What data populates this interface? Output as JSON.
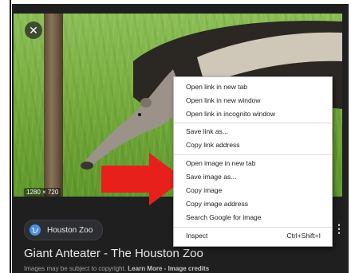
{
  "image_viewer": {
    "dimensions_label": "1280 × 720",
    "close_icon": "close-icon"
  },
  "source": {
    "name": "Houston Zoo",
    "icon": "globe-icon"
  },
  "result": {
    "title": "Giant Anteater - The Houston Zoo",
    "copyright_prefix": "Images may be subject to copyright.",
    "learn_more": "Learn More",
    "separator": "-",
    "image_credits": "Image credits"
  },
  "context_menu": {
    "group1": [
      "Open link in new tab",
      "Open link in new window",
      "Open link in incognito window"
    ],
    "group2": [
      "Save link as...",
      "Copy link address"
    ],
    "group3": [
      "Open image in new tab",
      "Save image as...",
      "Copy image",
      "Copy image address",
      "Search Google for image"
    ],
    "inspect": {
      "label": "Inspect",
      "shortcut": "Ctrl+Shift+I"
    }
  },
  "colors": {
    "panel_bg": "#1f1f1f",
    "arrow": "#e8201c",
    "grass": "#77ad3d"
  }
}
